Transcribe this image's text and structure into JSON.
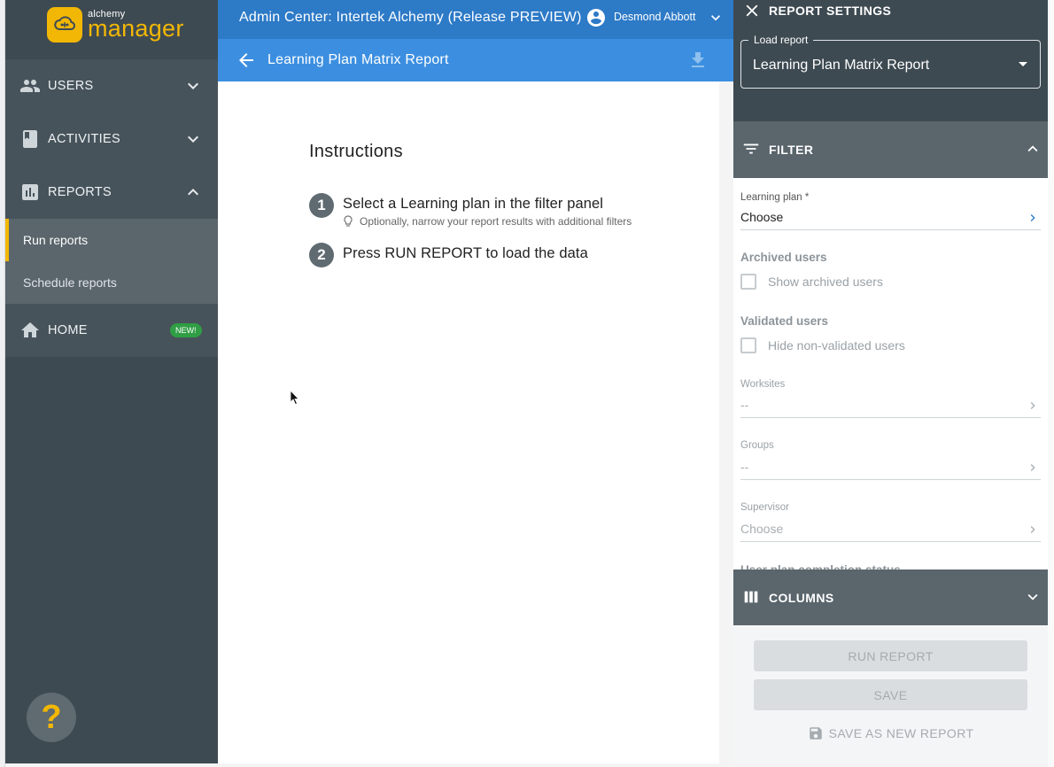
{
  "app": {
    "logo_small": "alchemy",
    "logo_big": "manager",
    "header_title": "Admin Center: Intertek Alchemy (Release PREVIEW)",
    "user_name": "Desmond Abbott"
  },
  "sidebar": {
    "items": [
      {
        "label": "USERS",
        "icon": "people-icon",
        "expanded": false
      },
      {
        "label": "ACTIVITIES",
        "icon": "book-icon",
        "expanded": false
      },
      {
        "label": "REPORTS",
        "icon": "bar-chart-icon",
        "expanded": true
      },
      {
        "label": "HOME",
        "icon": "home-icon",
        "badge": "NEW!"
      }
    ],
    "reports_sub": [
      {
        "label": "Run reports",
        "active": true
      },
      {
        "label": "Schedule reports",
        "active": false
      }
    ],
    "help_glyph": "?"
  },
  "page": {
    "title": "Learning Plan Matrix Report",
    "instructions_title": "Instructions",
    "steps": [
      {
        "num": "1",
        "text": "Select a Learning plan in the filter panel",
        "hint": "Optionally, narrow your report results with additional filters"
      },
      {
        "num": "2",
        "text": "Press RUN REPORT to load the data"
      }
    ]
  },
  "panel": {
    "title": "REPORT SETTINGS",
    "load_report_label": "Load report",
    "load_report_value": "Learning Plan Matrix Report",
    "filter_title": "FILTER",
    "filters": {
      "learning_plan_label": "Learning plan *",
      "learning_plan_value": "Choose",
      "archived_title": "Archived users",
      "archived_checkbox": "Show archived users",
      "validated_title": "Validated users",
      "validated_checkbox": "Hide non-validated users",
      "worksites_label": "Worksites",
      "worksites_value": "--",
      "groups_label": "Groups",
      "groups_value": "--",
      "supervisor_label": "Supervisor",
      "supervisor_value": "Choose",
      "next_peek": "User plan completion status"
    },
    "columns_title": "COLUMNS",
    "run_button": "RUN REPORT",
    "save_button": "SAVE",
    "save_new_button": "SAVE AS NEW REPORT"
  },
  "colors": {
    "sidebar_bg": "#3e4a52",
    "topbar_blue": "#2d7ac7",
    "subbar_blue": "#3c8fe0",
    "accent_yellow": "#f2b705",
    "new_badge_green": "#2f9e44"
  }
}
